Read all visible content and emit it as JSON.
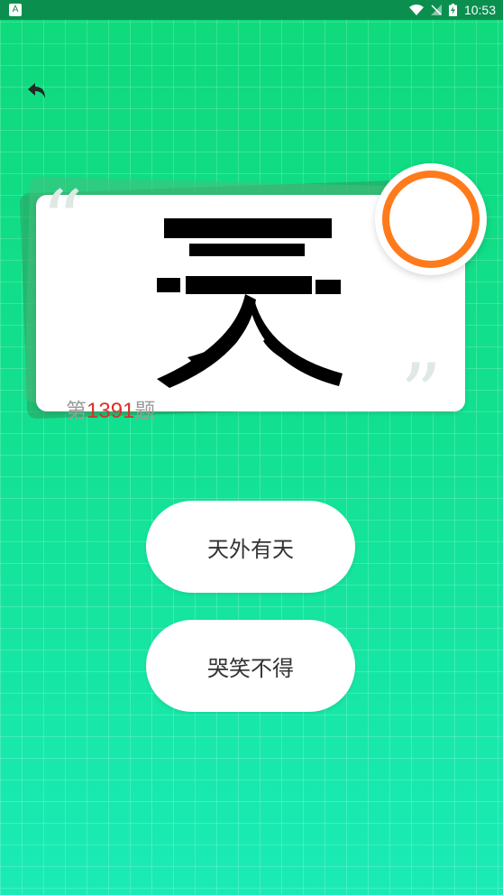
{
  "status_bar": {
    "time": "10:53",
    "app_badge": "A"
  },
  "icons": {
    "back": "back-arrow-icon",
    "wifi": "wifi-icon",
    "signal": "no-signal-icon",
    "battery": "battery-charging-icon",
    "timer": "countdown-ring"
  },
  "card": {
    "quote_open": "“",
    "quote_close": "”",
    "question_prefix": "第",
    "question_number": "1391",
    "question_suffix": "题"
  },
  "options": [
    {
      "label": "天外有天"
    },
    {
      "label": "哭笑不得"
    }
  ],
  "colors": {
    "accent": "#12e08f",
    "timer_ring": "#ff7a1a",
    "question_number": "#d8312a"
  }
}
